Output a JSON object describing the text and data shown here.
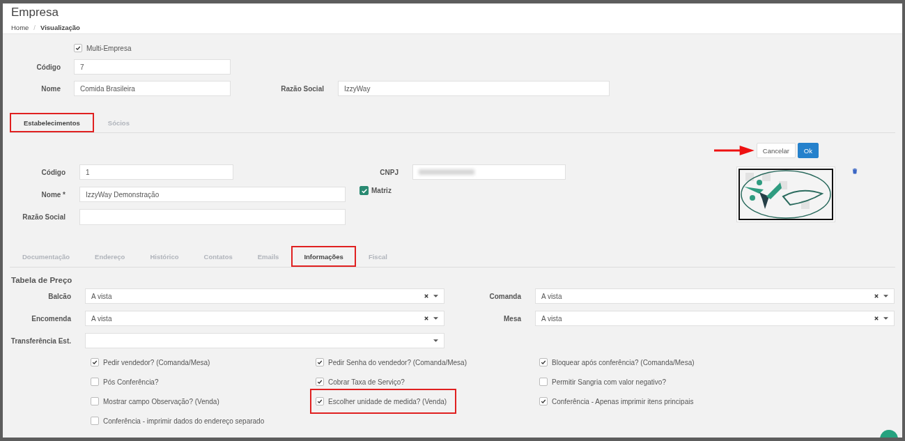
{
  "page": {
    "title": "Empresa",
    "separator": "/",
    "breadcrumb": [
      {
        "label": "Home",
        "current": false
      },
      {
        "label": "Visualização",
        "current": true
      }
    ]
  },
  "company": {
    "multi_empresa": {
      "label": "Multi-Empresa",
      "checked": true
    },
    "codigo": {
      "label": "Código",
      "value": "7"
    },
    "nome": {
      "label": "Nome",
      "value": "Comida Brasileira"
    },
    "razao_social": {
      "label": "Razão Social",
      "value": "IzzyWay"
    }
  },
  "tabs": [
    {
      "label": "Estabelecimentos",
      "selected": true,
      "highlighted": true
    },
    {
      "label": "Sócios",
      "selected": false,
      "highlighted": false
    }
  ],
  "establishment": {
    "buttons": [
      {
        "label": "Cancelar",
        "kind": "default"
      },
      {
        "label": "Ok",
        "kind": "primary"
      }
    ],
    "codigo": {
      "label": "Código",
      "value": "1"
    },
    "cnpj": {
      "label": "CNPJ",
      "redacted": true
    },
    "nome": {
      "label": "Nome *",
      "value": "IzzyWay Demonstração"
    },
    "matriz": {
      "label": "Matriz",
      "checked": true
    },
    "razao_social": {
      "label": "Razão Social"
    }
  },
  "sub_tabs": [
    {
      "label": "Documentação",
      "selected": false,
      "highlighted": false
    },
    {
      "label": "Endereço",
      "selected": false,
      "highlighted": false
    },
    {
      "label": "Histórico",
      "selected": false,
      "highlighted": false
    },
    {
      "label": "Contatos",
      "selected": false,
      "highlighted": false
    },
    {
      "label": "Emails",
      "selected": false,
      "highlighted": false
    },
    {
      "label": "Informações",
      "selected": true,
      "highlighted": true
    },
    {
      "label": "Fiscal",
      "selected": false,
      "highlighted": false
    }
  ],
  "price_table": {
    "title": "Tabela de Preço",
    "selects": [
      {
        "label": "Balcão",
        "value": "A vista",
        "clearable": true
      },
      {
        "label": "Comanda",
        "value": "A vista",
        "clearable": true
      },
      {
        "label": "Encomenda",
        "value": "A vista",
        "clearable": true
      },
      {
        "label": "Mesa",
        "value": "A vista",
        "clearable": true
      },
      {
        "label": "Transferência Est.",
        "clearable": false
      }
    ]
  },
  "options": [
    {
      "label": "Pedir vendedor? (Comanda/Mesa)",
      "checked": true,
      "highlighted": false
    },
    {
      "label": "Pedir Senha do vendedor? (Comanda/Mesa)",
      "checked": true,
      "highlighted": false
    },
    {
      "label": "Bloquear após conferência? (Comanda/Mesa)",
      "checked": true,
      "highlighted": false
    },
    {
      "label": "Pós Conferência?",
      "checked": false,
      "highlighted": false
    },
    {
      "label": "Cobrar Taxa de Serviço?",
      "checked": true,
      "highlighted": false
    },
    {
      "label": "Permitir Sangria com valor negativo?",
      "checked": false,
      "highlighted": false
    },
    {
      "label": "Mostrar campo Observação? (Venda)",
      "checked": false,
      "highlighted": false
    },
    {
      "label": "Escolher unidade de medida? (Venda)",
      "checked": true,
      "highlighted": true
    },
    {
      "label": "Conferência - Apenas imprimir itens principais",
      "checked": true,
      "highlighted": false
    },
    {
      "label": "Conferência - imprimir dados do endereço separado",
      "checked": false,
      "highlighted": false
    }
  ]
}
